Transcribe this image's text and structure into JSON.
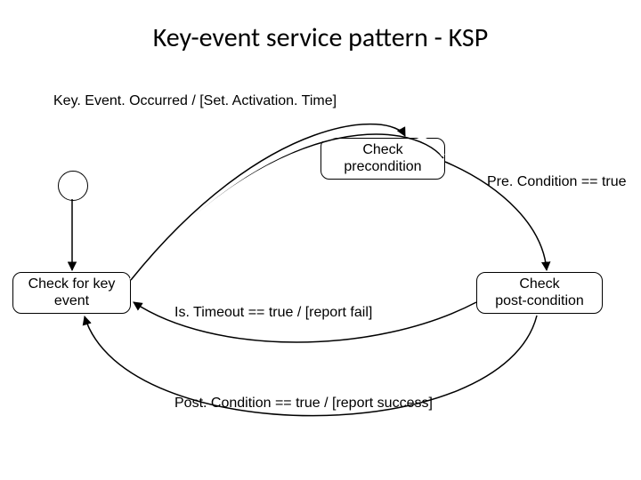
{
  "title": "Key-event service pattern - KSP",
  "labels": {
    "trigger": "Key. Event. Occurred / [Set. Activation. Time]",
    "pre_true": "Pre. Condition == true",
    "timeout": "Is. Timeout == true / [report fail]",
    "post_true": "Post. Condition == true / [report success]"
  },
  "states": {
    "check_key": "Check for key\nevent",
    "check_pre": "Check\nprecondition",
    "check_post": "Check\npost-condition"
  }
}
